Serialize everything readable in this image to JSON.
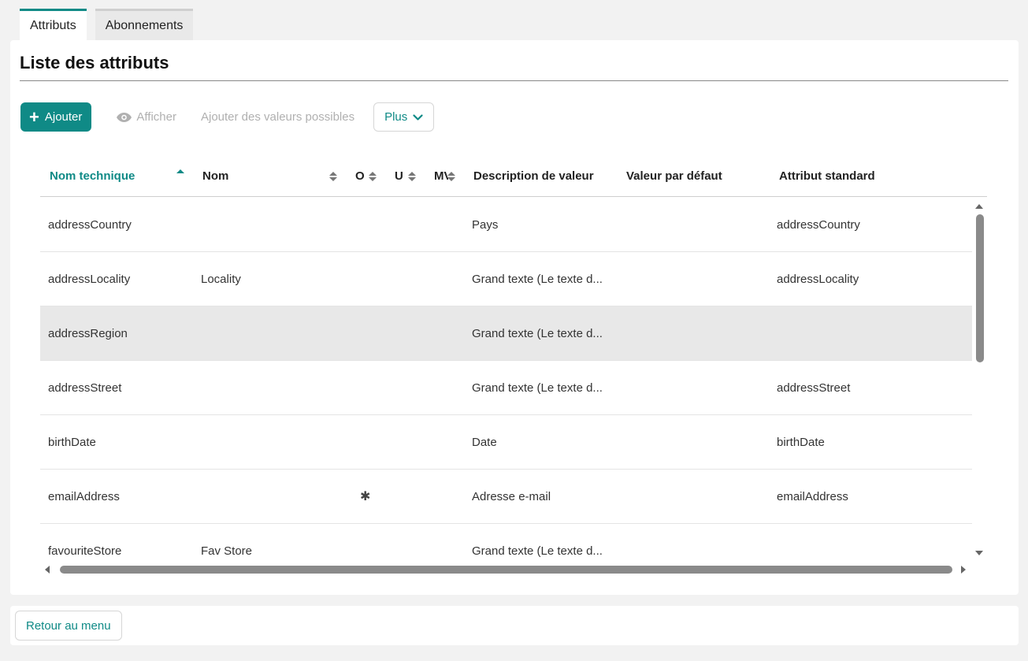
{
  "tabs": [
    {
      "label": "Attributs",
      "active": true
    },
    {
      "label": "Abonnements",
      "active": false
    }
  ],
  "page": {
    "title": "Liste des attributs"
  },
  "toolbar": {
    "add_label": "Ajouter",
    "view_label": "Afficher",
    "add_values_label": "Ajouter des valeurs possibles",
    "more_label": "Plus"
  },
  "table": {
    "columns": [
      {
        "label": "Nom technique",
        "sort": "ascending"
      },
      {
        "label": "Nom",
        "sort": "none"
      },
      {
        "label": "O",
        "sort": "none"
      },
      {
        "label": "U",
        "sort": "none"
      },
      {
        "label": "MV",
        "sort": "none"
      },
      {
        "label": "Description de valeur",
        "sort": "none"
      },
      {
        "label": "Valeur par défaut",
        "sort": "none"
      },
      {
        "label": "Attribut standard",
        "sort": "none"
      }
    ],
    "rows": [
      {
        "technical": "addressCountry",
        "name": "",
        "o": "",
        "desc": "Pays",
        "default": "",
        "standard": "addressCountry"
      },
      {
        "technical": "addressLocality",
        "name": "Locality",
        "o": "",
        "desc": "Grand texte (Le texte d...",
        "default": "",
        "standard": "addressLocality"
      },
      {
        "technical": "addressRegion",
        "name": "",
        "o": "",
        "desc": "Grand texte (Le texte d...",
        "default": "",
        "standard": "",
        "selected": true
      },
      {
        "technical": "addressStreet",
        "name": "",
        "o": "",
        "desc": "Grand texte (Le texte d...",
        "default": "",
        "standard": "addressStreet"
      },
      {
        "technical": "birthDate",
        "name": "",
        "o": "",
        "desc": "Date",
        "default": "",
        "standard": "birthDate"
      },
      {
        "technical": "emailAddress",
        "name": "",
        "o": "✱",
        "desc": "Adresse e-mail",
        "default": "",
        "standard": "emailAddress"
      },
      {
        "technical": "favouriteStore",
        "name": "Fav Store",
        "o": "",
        "desc": "Grand texte (Le texte d...",
        "default": "",
        "standard": ""
      }
    ]
  },
  "footer": {
    "back_label": "Retour au menu"
  },
  "colors": {
    "accent": "#0f8a86",
    "selected_row": "#e8e8e8"
  }
}
